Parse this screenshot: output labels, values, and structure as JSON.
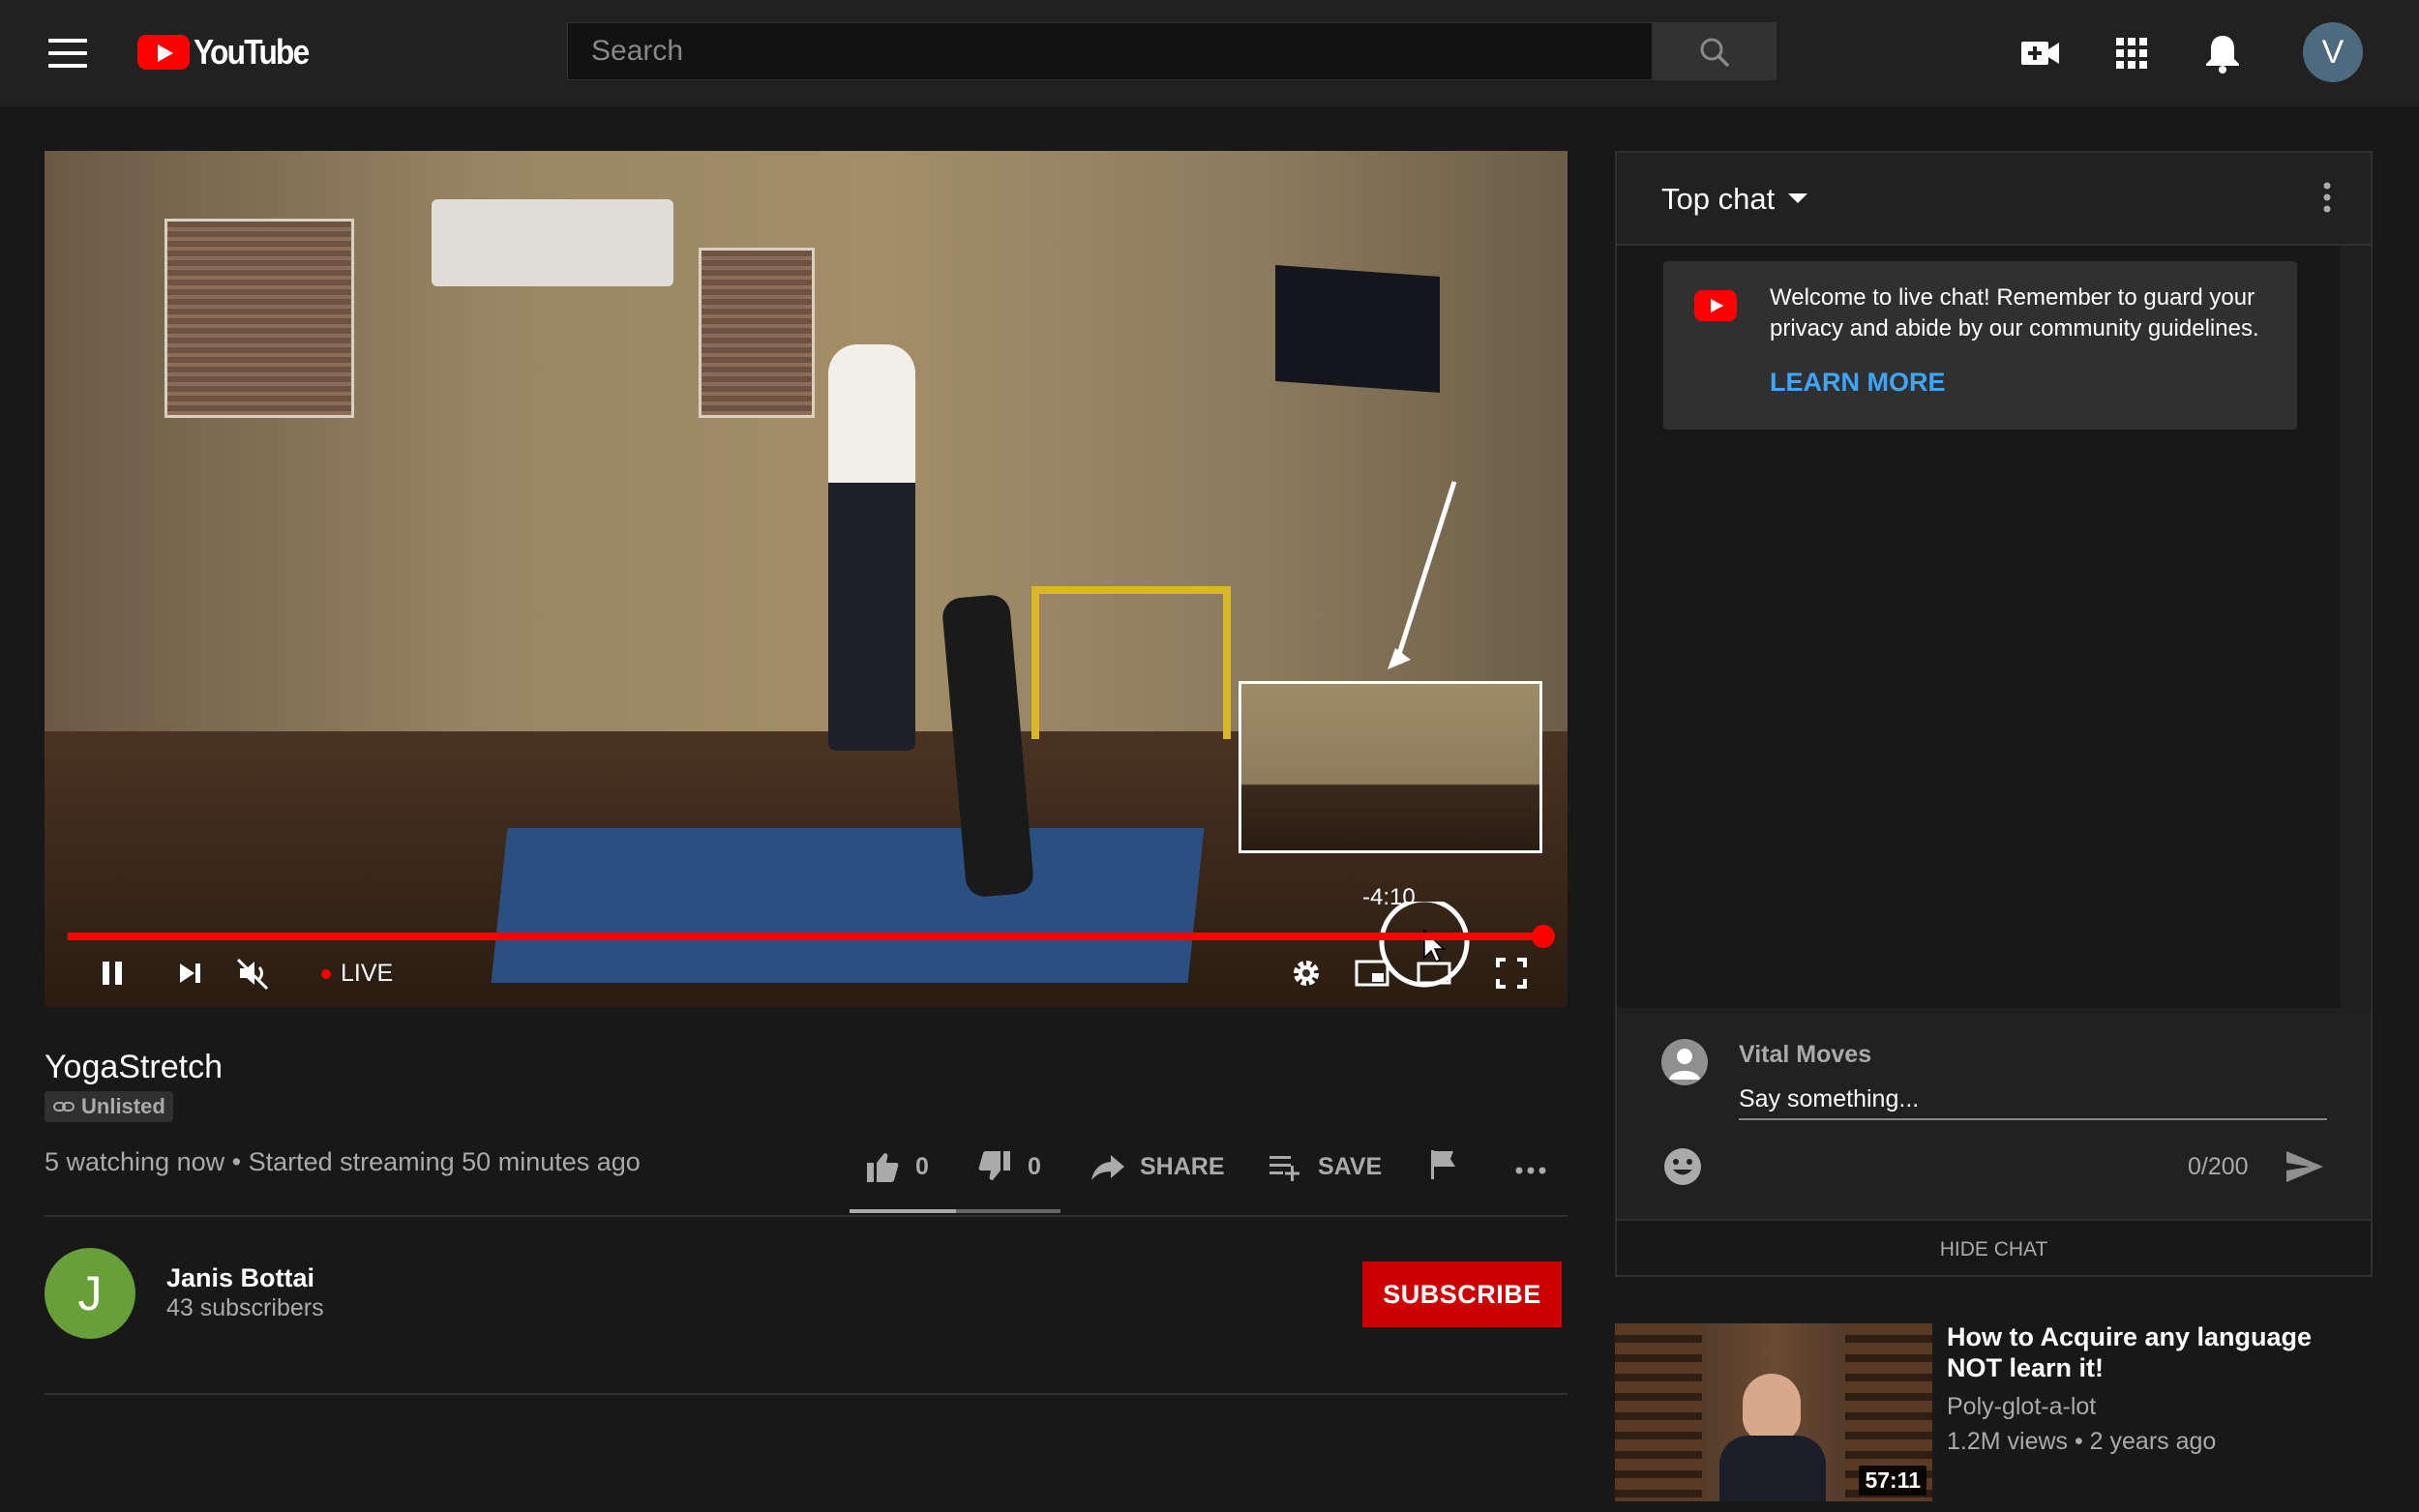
{
  "header": {
    "logo_text": "YouTube",
    "search_placeholder": "Search",
    "avatar_initial": "V"
  },
  "player": {
    "hover_time": "-4:10",
    "live_label": "LIVE",
    "progress": 1.0
  },
  "video": {
    "title": "YogaStretch",
    "privacy_badge": "Unlisted",
    "meta": "5 watching now • Started streaming 50 minutes ago",
    "likes": "0",
    "dislikes": "0",
    "share_label": "SHARE",
    "save_label": "SAVE"
  },
  "channel": {
    "initial": "J",
    "name": "Janis Bottai",
    "subscribers": "43 subscribers",
    "subscribe_label": "SUBSCRIBE"
  },
  "chat": {
    "title": "Top chat",
    "welcome_message": "Welcome to live chat! Remember to guard your privacy and abide by our community guidelines.",
    "learn_more": "LEARN MORE",
    "user_name": "Vital Moves",
    "input_placeholder": "Say something...",
    "char_count": "0/200",
    "hide_chat": "HIDE CHAT"
  },
  "recommendation": {
    "title": "How to Acquire any language NOT learn it!",
    "channel": "Poly-glot-a-lot",
    "meta": "1.2M views • 2 years ago",
    "duration": "57:11"
  },
  "colors": {
    "accent": "#ff0000",
    "subscribe": "#cc0000",
    "link": "#3ea6ff",
    "background": "#181818",
    "masthead": "#212121"
  }
}
